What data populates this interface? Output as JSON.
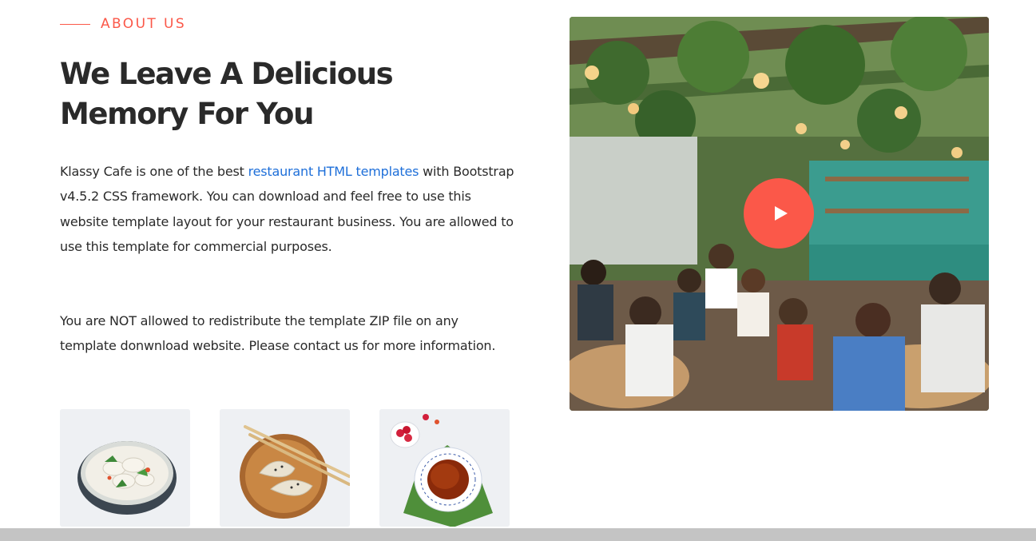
{
  "section": {
    "eyebrow": "ABOUT US",
    "title_line1": "We Leave A Delicious",
    "title_line2": "Memory For You"
  },
  "paragraph1": {
    "before_link": "Klassy Cafe is one of the best ",
    "link_text": "restaurant HTML templates",
    "after_link": " with Bootstrap v4.5.2 CSS framework. You can download and feel free to use this website template layout for your restaurant business. You are allowed to use this template for commercial purposes."
  },
  "paragraph2": {
    "text": "You are NOT allowed to redistribute the template ZIP file on any template donwnload website. Please contact us for more information."
  },
  "thumbnails": [
    {
      "icon": "dumplings-bowl-image"
    },
    {
      "icon": "dumplings-plate-image"
    },
    {
      "icon": "tea-cup-image"
    }
  ],
  "video": {
    "icon": "restaurant-interior-image",
    "play_icon": "play-icon"
  },
  "colors": {
    "accent": "#fb5849",
    "link": "#1e6fd9",
    "heading": "#2a2a2a",
    "bottom_bar": "#c4c4c4"
  }
}
